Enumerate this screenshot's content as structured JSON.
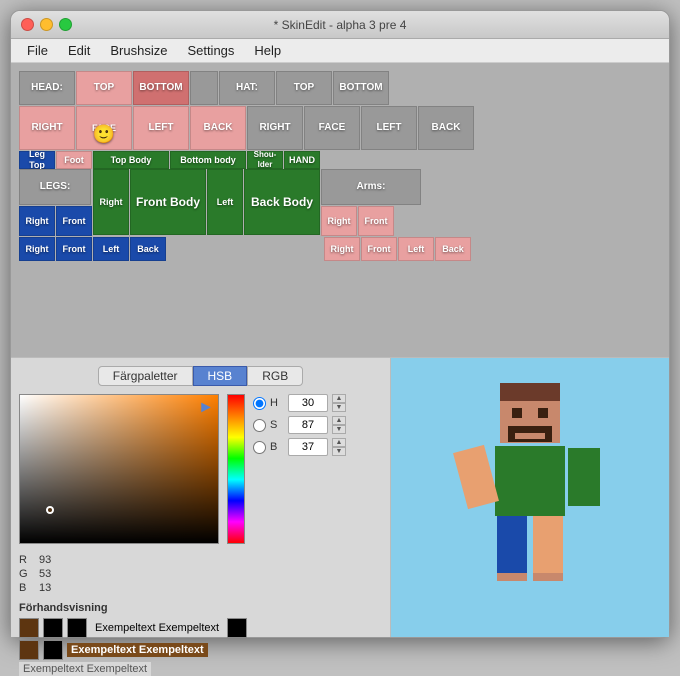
{
  "window": {
    "title": "* SkinEdit - alpha 3 pre 4"
  },
  "menu": {
    "items": [
      "File",
      "Edit",
      "Brushsize",
      "Settings",
      "Help"
    ]
  },
  "tabs": {
    "items": [
      "Färgpaletter",
      "HSB",
      "RGB"
    ],
    "active": 1
  },
  "hsb": {
    "h_label": "H",
    "s_label": "S",
    "b_label": "B",
    "h_value": "30",
    "s_value": "87",
    "b_value": "37"
  },
  "rgb": {
    "r_label": "R",
    "g_label": "G",
    "b_label": "B",
    "r_value": "93",
    "g_value": "53",
    "b_value": "13"
  },
  "preview": {
    "label": "Förhandsvisning",
    "rows": [
      {
        "bg": "#5d3510",
        "fg": "#000",
        "text": "Exempeltext Exempeltext"
      },
      {
        "bg": "#7a4a1a",
        "fg": "#fff",
        "text": "Exempeltext Exempeltext"
      },
      {
        "bg": "#5d3510",
        "fg": "#ddd",
        "text": "Exempeltext Exempeltext"
      }
    ]
  },
  "skin_blocks": {
    "head_label": "HEAD:",
    "hat_label": "HAT:",
    "legs_label": "LEGS:",
    "arms_label": "Arms:",
    "top": "TOP",
    "bottom": "BOTTOM",
    "right": "RIGHT",
    "left": "LEFT",
    "back": "BACK",
    "face": "FACE",
    "front_body": "Front Body",
    "back_body": "Back Body",
    "top_body": "Top Body",
    "bottom_body": "Bottom body",
    "leg_top": "Leg Top",
    "foot": "Foot",
    "shoulder": "Shou- lder",
    "hand": "HAND",
    "right_label": "Right",
    "left_label": "Left",
    "front_label": "Front",
    "back_label": "Back"
  }
}
